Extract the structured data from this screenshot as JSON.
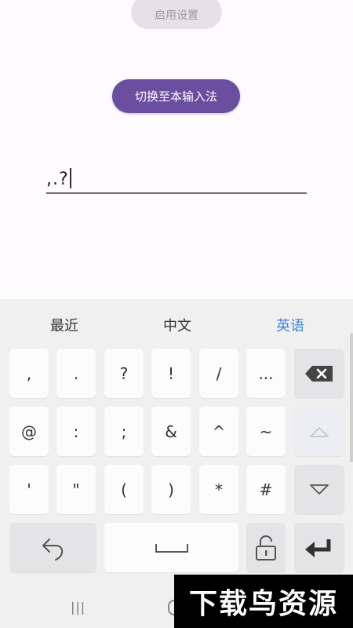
{
  "buttons": {
    "enable_settings": "启用设置",
    "switch_ime": "切换至本输入法"
  },
  "input": {
    "value": ",.?"
  },
  "keyboard": {
    "tabs": {
      "recent": "最近",
      "chinese": "中文",
      "english": "英语",
      "active": "english"
    },
    "row1": [
      ",",
      ".",
      "?",
      "!",
      "/",
      "..."
    ],
    "row2": [
      "@",
      ":",
      ";",
      "&",
      "^",
      "~"
    ],
    "row3": [
      "'",
      "\"",
      "(",
      ")",
      "*",
      "#"
    ],
    "icons": {
      "delete": "backspace-icon",
      "shift": "up-arrow-icon",
      "down": "down-arrow-icon",
      "undo": "undo-icon",
      "space": "space-icon",
      "lock": "lock-icon",
      "enter": "enter-icon"
    }
  },
  "navbar": {
    "recents_glyph": "|||"
  },
  "watermark": {
    "text": "下载鸟资源"
  },
  "colors": {
    "accent": "#6a4fa0",
    "active_tab": "#3f8ad8",
    "keyboard_bg": "#f0f0f0",
    "key_bg": "#fcfcfc"
  }
}
